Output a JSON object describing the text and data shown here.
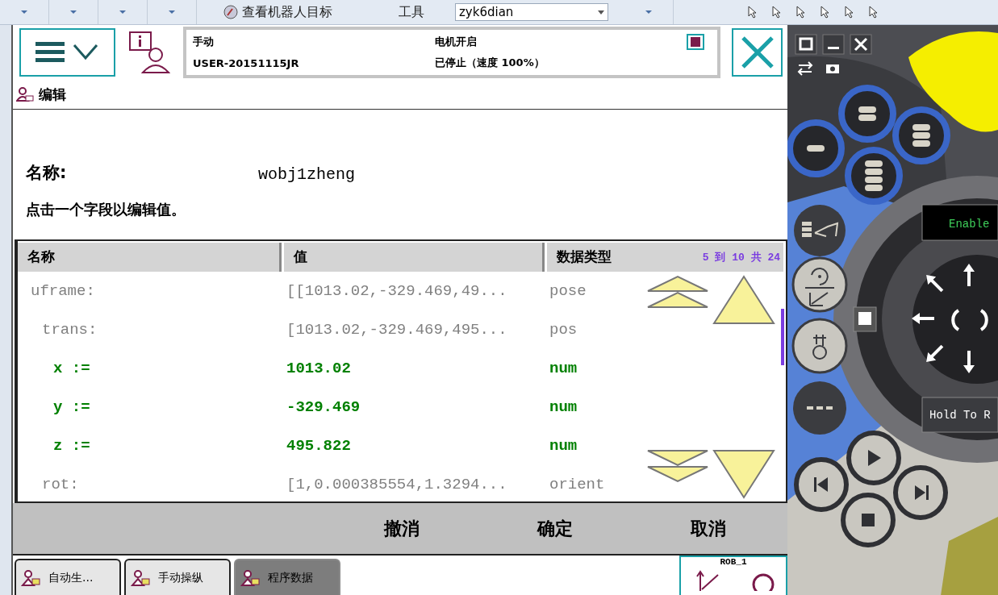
{
  "toolbar": {
    "view_button": "查看机器人目标",
    "tool_label": "工具",
    "tool_value": "zyk6dian"
  },
  "header": {
    "mode": "手动",
    "controller": "USER-20151115JR",
    "motor": "电机开启",
    "state": "已停止（速度 100%）"
  },
  "page_title": "编辑",
  "name_label": "名称:",
  "name_value": "wobj1zheng",
  "hint": "点击一个字段以编辑值。",
  "table": {
    "columns": [
      "名称",
      "值",
      "数据类型"
    ],
    "range": "5 到 10 共 24",
    "rows": [
      {
        "name": "uframe:",
        "value": "[[1013.02,-329.469,49...",
        "type": "pose",
        "editable": false,
        "children": [
          {
            "name": "trans:",
            "value": "[1013.02,-329.469,495...",
            "type": "pos",
            "editable": false,
            "children": [
              {
                "name": "x :=",
                "value": "1013.02",
                "type": "num",
                "editable": true
              },
              {
                "name": "y :=",
                "value": "-329.469",
                "type": "num",
                "editable": true
              },
              {
                "name": "z :=",
                "value": "495.822",
                "type": "num",
                "editable": true
              }
            ]
          },
          {
            "name": "rot:",
            "value": "[1,0.000385554,1.3294...",
            "type": "orient",
            "editable": false
          }
        ]
      }
    ]
  },
  "actions": [
    "撤消",
    "确定",
    "取消"
  ],
  "taskbar": {
    "tabs": [
      {
        "label": "自动生...",
        "selected": false
      },
      {
        "label": "手动操纵",
        "selected": false
      },
      {
        "label": "程序数据",
        "selected": true
      }
    ],
    "robot": "ROB_1"
  },
  "pendant": {
    "enable": "Enable",
    "hold": "Hold To R"
  }
}
